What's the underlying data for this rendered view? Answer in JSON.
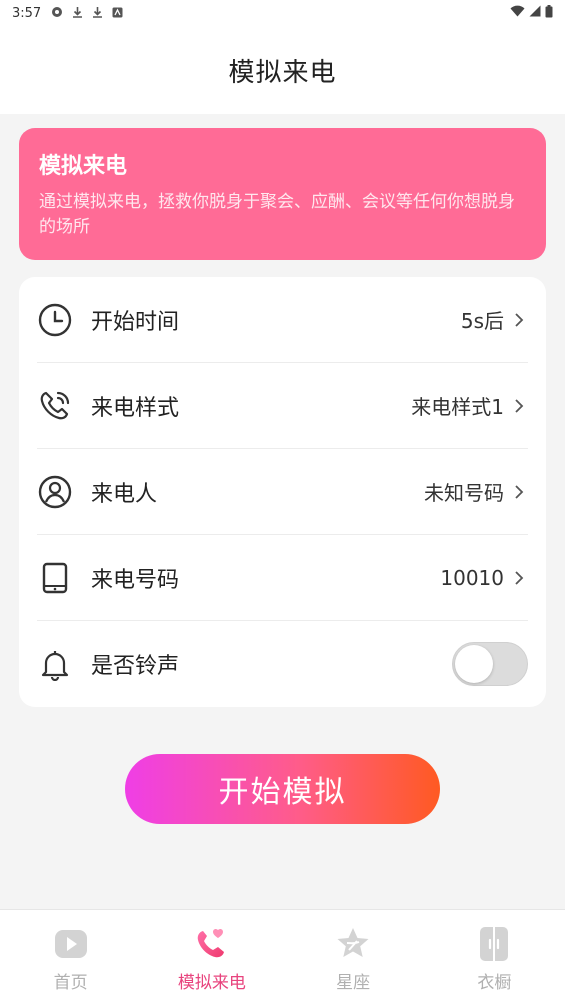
{
  "status_bar": {
    "time": "3:57"
  },
  "header": {
    "title": "模拟来电"
  },
  "banner": {
    "title": "模拟来电",
    "description": "通过模拟来电，拯救你脱身于聚会、应酬、会议等任何你想脱身的场所",
    "color": "#ff6b96"
  },
  "settings": {
    "rows": [
      {
        "icon": "clock-icon",
        "label": "开始时间",
        "value": "5s后"
      },
      {
        "icon": "phone-call-icon",
        "label": "来电样式",
        "value": "来电样式1"
      },
      {
        "icon": "user-icon",
        "label": "来电人",
        "value": "未知号码"
      },
      {
        "icon": "tablet-icon",
        "label": "来电号码",
        "value": "10010"
      },
      {
        "icon": "bell-icon",
        "label": "是否铃声",
        "toggle_on": false
      }
    ]
  },
  "start_button": {
    "label": "开始模拟"
  },
  "bottom_nav": {
    "items": [
      {
        "icon": "play-icon",
        "label": "首页",
        "active": false
      },
      {
        "icon": "phone-heart-icon",
        "label": "模拟来电",
        "active": true
      },
      {
        "icon": "star-icon",
        "label": "星座",
        "active": false
      },
      {
        "icon": "wardrobe-icon",
        "label": "衣橱",
        "active": false
      }
    ],
    "active_color": "#e8447e",
    "inactive_color": "#b0b0b0"
  }
}
